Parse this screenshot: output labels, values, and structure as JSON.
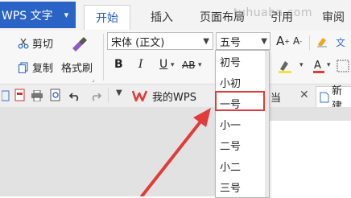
{
  "app": {
    "title": "WPS 文字",
    "caret": "▾",
    "brand_color": "#2a63c6"
  },
  "tabs": [
    {
      "label": "开始",
      "active": true
    },
    {
      "label": "插入"
    },
    {
      "label": "页面布局"
    },
    {
      "label": "引用"
    },
    {
      "label": "审阅"
    }
  ],
  "watermark": "tuhuaba.com",
  "clipboard": {
    "cut_label": "剪切",
    "copy_label": "复制",
    "format_painter_label": "格式刷"
  },
  "font": {
    "name": "宋体 (正文)",
    "size": "五号"
  },
  "format": {
    "bold": "B",
    "italic": "I",
    "underline": "U",
    "strikethrough": "AB",
    "increase_font": "A",
    "decrease_font": "A"
  },
  "doc_tabs": {
    "wps_tab": "我的WPS",
    "doc_fragment": "当",
    "new_tab_partial": "新建"
  },
  "font_size_dropdown": {
    "items": [
      "初号",
      "小初",
      "一号",
      "小一",
      "二号",
      "小二",
      "三号"
    ],
    "highlighted": "一号"
  },
  "colors": {
    "highlight_border": "#e23b3b",
    "arrow": "#e23b3b",
    "accent": "#1f5bd0"
  }
}
